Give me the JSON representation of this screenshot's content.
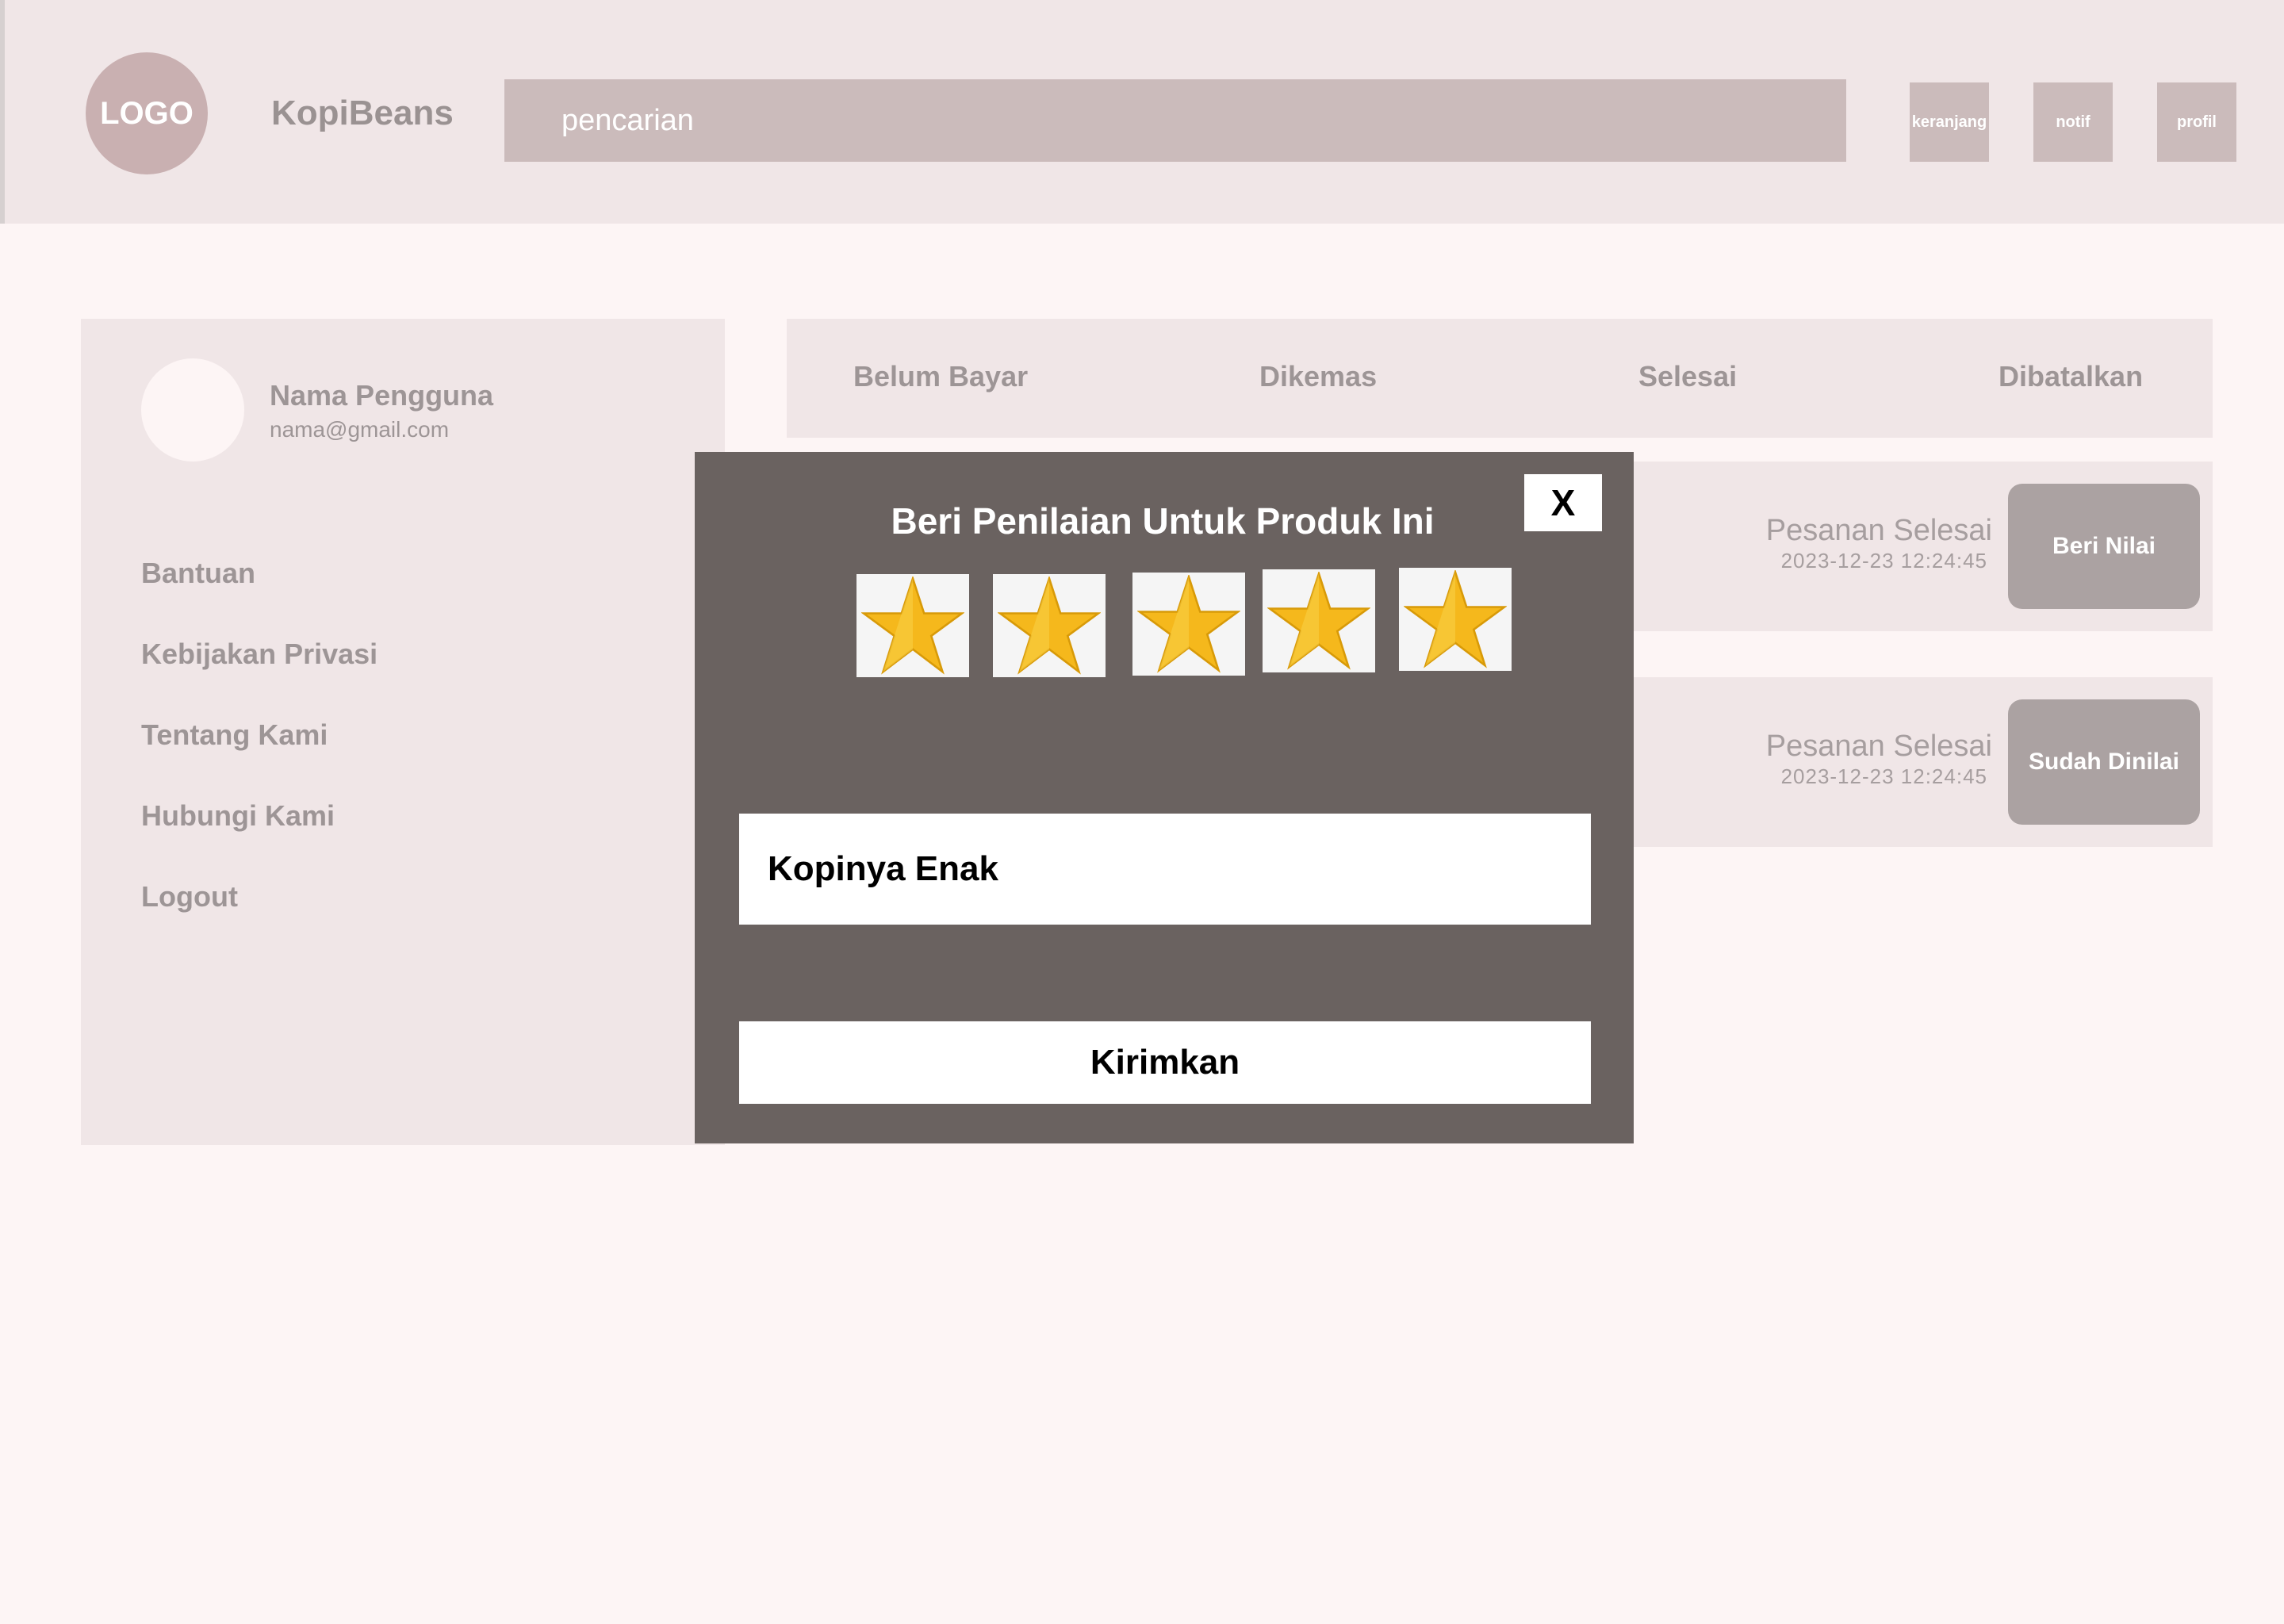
{
  "header": {
    "logo_text": "LOGO",
    "brand": "KopiBeans",
    "search_placeholder": "pencarian",
    "buttons": [
      "keranjang",
      "notif",
      "profil"
    ]
  },
  "sidebar": {
    "user_name": "Nama Pengguna",
    "user_email": "nama@gmail.com",
    "items": [
      "Bantuan",
      "Kebijakan Privasi",
      "Tentang Kami",
      "Hubungi Kami",
      "Logout"
    ]
  },
  "tabs": [
    "Belum Bayar",
    "Dikemas",
    "Selesai",
    "Dibatalkan"
  ],
  "orders": [
    {
      "status": "Pesanan Selesai",
      "date": "2023-12-23 12:24:45",
      "button": "Beri Nilai"
    },
    {
      "status": "Pesanan Selesai",
      "date": "2023-12-23 12:24:45",
      "button": "Sudah Dinilai"
    }
  ],
  "modal": {
    "title": "Beri Penilaian Untuk Produk Ini",
    "close_label": "X",
    "rating": 5,
    "rating_max": 5,
    "review_value": "Kopinya Enak",
    "submit_label": "Kirimkan"
  },
  "colors": {
    "header_bg": "#f0e6e7",
    "page_bg": "#fdf5f5",
    "accent": "#cbbbbb",
    "modal_bg": "#6a6260",
    "star_fill": "#f5b81c"
  }
}
